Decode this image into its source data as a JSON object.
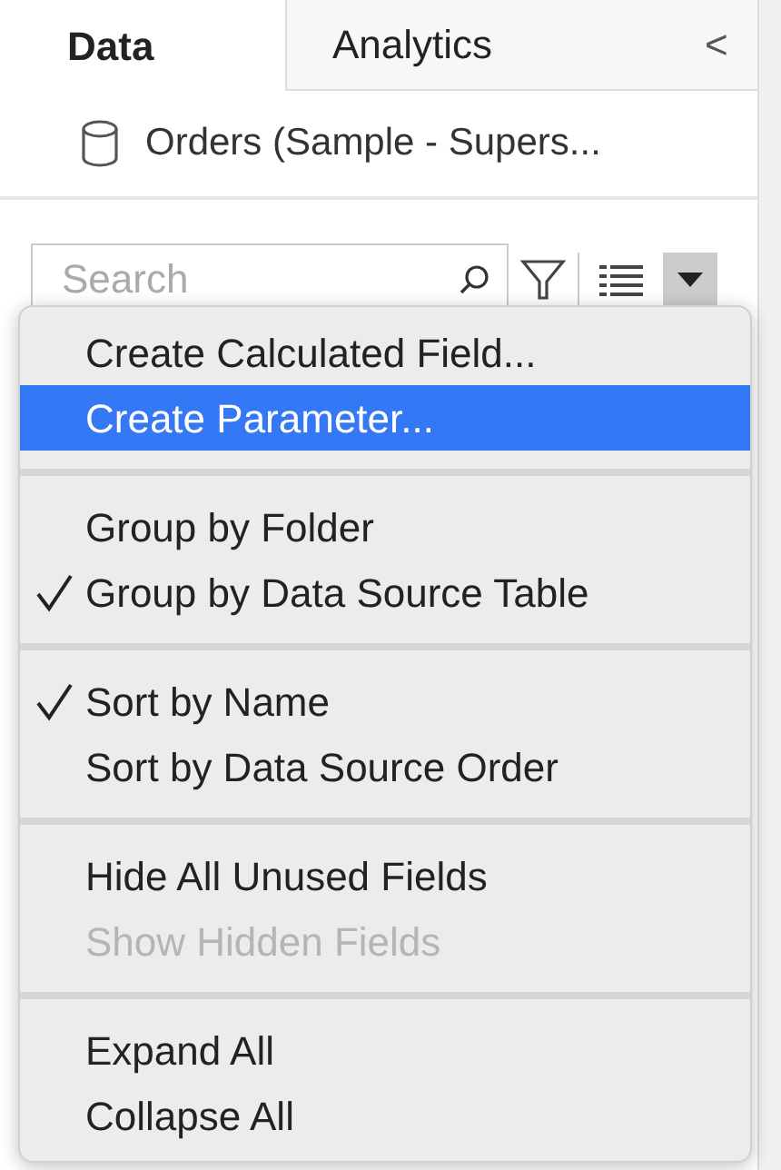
{
  "tabs": [
    {
      "label": "Data",
      "selected": true
    },
    {
      "label": "Analytics",
      "selected": false
    }
  ],
  "collapse_button": "<",
  "data_source": "Orders (Sample - Supers...",
  "search": {
    "placeholder": "Search"
  },
  "menu": [
    {
      "kind": "item",
      "label": "Create Calculated Field...",
      "checked": false,
      "disabled": false,
      "selected": false
    },
    {
      "kind": "item",
      "label": "Create Parameter...",
      "checked": false,
      "disabled": false,
      "selected": true
    },
    {
      "kind": "separator"
    },
    {
      "kind": "item",
      "label": "Group by Folder",
      "checked": false,
      "disabled": false,
      "selected": false
    },
    {
      "kind": "item",
      "label": "Group by Data Source Table",
      "checked": true,
      "disabled": false,
      "selected": false
    },
    {
      "kind": "separator"
    },
    {
      "kind": "item",
      "label": "Sort by Name",
      "checked": true,
      "disabled": false,
      "selected": false
    },
    {
      "kind": "item",
      "label": "Sort by Data Source Order",
      "checked": false,
      "disabled": false,
      "selected": false
    },
    {
      "kind": "separator"
    },
    {
      "kind": "item",
      "label": "Hide All Unused Fields",
      "checked": false,
      "disabled": false,
      "selected": false
    },
    {
      "kind": "item",
      "label": "Show Hidden Fields",
      "checked": false,
      "disabled": true,
      "selected": false
    },
    {
      "kind": "separator"
    },
    {
      "kind": "item",
      "label": "Expand All",
      "checked": false,
      "disabled": false,
      "selected": false
    },
    {
      "kind": "item",
      "label": "Collapse All",
      "checked": false,
      "disabled": false,
      "selected": false
    }
  ]
}
